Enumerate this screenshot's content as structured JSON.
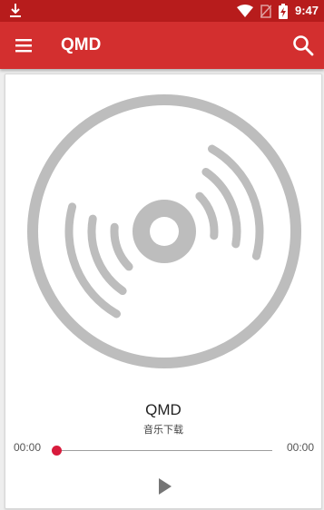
{
  "status_bar": {
    "time": "9:47",
    "icons": [
      "download-icon",
      "wifi-icon",
      "no-sim-icon",
      "battery-charging-icon"
    ]
  },
  "app_bar": {
    "title": "QMD",
    "menu_icon": "hamburger-menu-icon",
    "search_icon": "search-icon"
  },
  "player": {
    "artwork_icon": "vinyl-disc-icon",
    "track_title": "QMD",
    "track_subtitle": "音乐下载",
    "current_time": "00:00",
    "total_time": "00:00",
    "progress": 0,
    "play_icon": "play-icon"
  },
  "colors": {
    "status_bar": "#b71c1c",
    "app_bar": "#d32f2f",
    "accent": "#d81b3c",
    "disc": "#bdbdbd"
  }
}
